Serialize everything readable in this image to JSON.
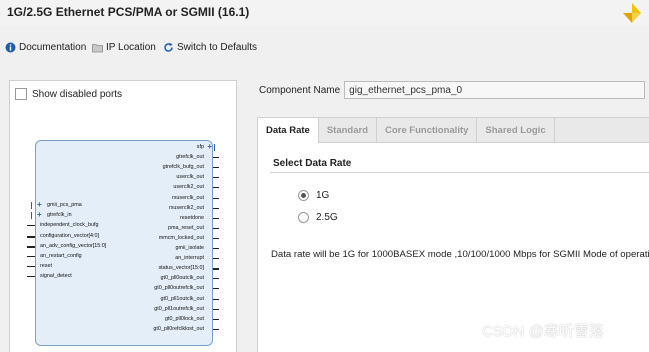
{
  "window": {
    "title": "1G/2.5G Ethernet PCS/PMA or SGMII (16.1)"
  },
  "toolbar": {
    "documentation": "Documentation",
    "ip_location": "IP Location",
    "switch_defaults": "Switch to Defaults"
  },
  "left_panel": {
    "show_disabled_ports": "Show disabled ports",
    "block": {
      "right_ports": [
        "sfp",
        "gtrefclk_out",
        "gtrefclk_bufg_out",
        "userclk_out",
        "userclk2_out",
        "rxuserclk_out",
        "rxuserclk2_out",
        "resetdone",
        "pma_reset_out",
        "mmcm_locked_out",
        "gmii_isolate",
        "an_interrupt",
        "status_vector[15:0]",
        "gt0_pll0outclk_out",
        "gt0_pll0outrefclk_out",
        "gt0_pll1outclk_out",
        "gt0_pll1outrefclk_out",
        "gt0_pll0lock_out",
        "gt0_pll0refclklost_out"
      ],
      "left_ports": [
        "gmii_pcs_pma",
        "gtrefclk_in",
        "independent_clock_bufg",
        "configuration_vector[4:0]",
        "an_adv_config_vector[15:0]",
        "an_restart_config",
        "reset",
        "signal_detect"
      ]
    }
  },
  "component": {
    "label": "Component Name",
    "value": "gig_ethernet_pcs_pma_0"
  },
  "tabs": [
    "Data Rate",
    "Standard",
    "Core Functionality",
    "Shared Logic"
  ],
  "data_rate": {
    "section_title": "Select Data Rate",
    "options": [
      {
        "label": "1G",
        "selected": true
      },
      {
        "label": "2.5G",
        "selected": false
      }
    ],
    "info": "Data rate will be 1G for 1000BASEX mode ,10/100/1000 Mbps for SGMII Mode of operatio"
  },
  "watermark": "CSDN @寒听雪落"
}
